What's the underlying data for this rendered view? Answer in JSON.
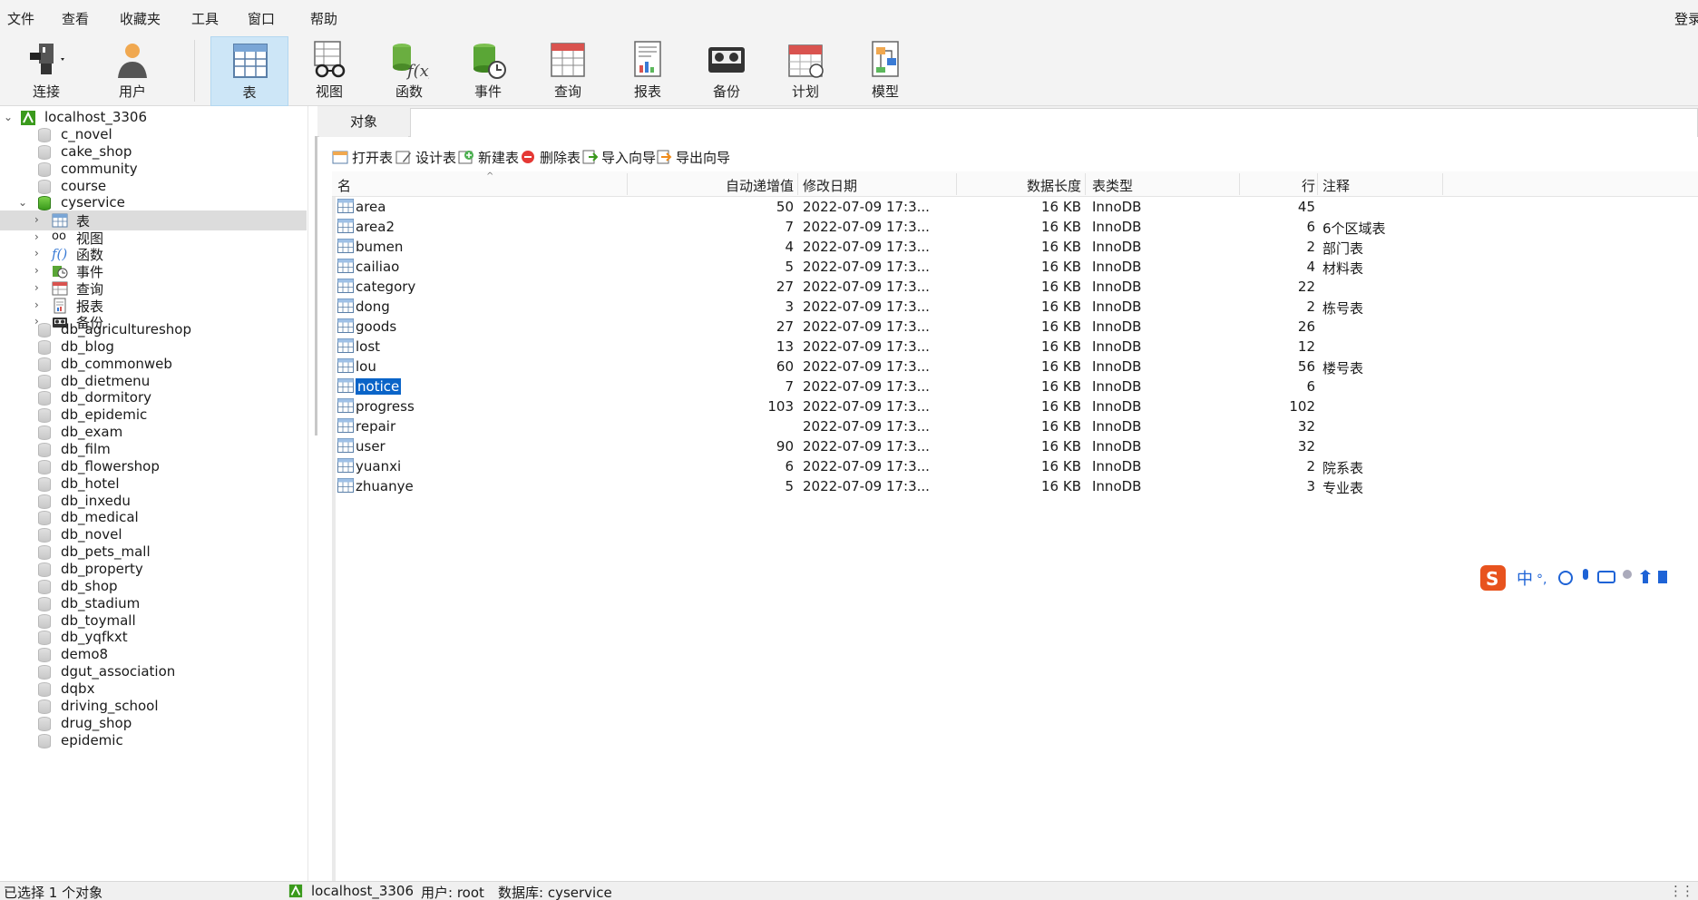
{
  "menu": {
    "items": [
      "文件",
      "查看",
      "收藏夹",
      "工具",
      "窗口",
      "帮助"
    ],
    "login": "登录"
  },
  "toolbar": {
    "buttons": [
      {
        "label": "连接",
        "icon": "connection-plug-icon"
      },
      {
        "label": "用户",
        "icon": "user-icon"
      },
      {
        "label": "表",
        "icon": "table-icon",
        "active": true
      },
      {
        "label": "视图",
        "icon": "view-glasses-icon"
      },
      {
        "label": "函数",
        "icon": "function-icon"
      },
      {
        "label": "事件",
        "icon": "event-clock-icon"
      },
      {
        "label": "查询",
        "icon": "query-icon"
      },
      {
        "label": "报表",
        "icon": "report-icon"
      },
      {
        "label": "备份",
        "icon": "backup-icon"
      },
      {
        "label": "计划",
        "icon": "schedule-calendar-icon"
      },
      {
        "label": "模型",
        "icon": "model-icon"
      }
    ]
  },
  "sidebar": {
    "connection": "localhost_3306",
    "databases_top": [
      "c_novel",
      "cake_shop",
      "community",
      "course"
    ],
    "open_db": "cyservice",
    "open_db_children": [
      {
        "label": "表",
        "icon": "table-icon",
        "selected": true
      },
      {
        "label": "视图",
        "icon": "view-glasses-icon"
      },
      {
        "label": "函数",
        "icon": "function-icon"
      },
      {
        "label": "事件",
        "icon": "event-clock-icon"
      },
      {
        "label": "查询",
        "icon": "query-icon"
      },
      {
        "label": "报表",
        "icon": "report-icon"
      },
      {
        "label": "备份",
        "icon": "backup-icon"
      }
    ],
    "databases_bottom": [
      "db_agricultureshop",
      "db_blog",
      "db_commonweb",
      "db_dietmenu",
      "db_dormitory",
      "db_epidemic",
      "db_exam",
      "db_film",
      "db_flowershop",
      "db_hotel",
      "db_inxedu",
      "db_medical",
      "db_novel",
      "db_pets_mall",
      "db_property",
      "db_shop",
      "db_stadium",
      "db_toymall",
      "db_yqfkxt",
      "demo8",
      "dgut_association",
      "dqbx",
      "driving_school",
      "drug_shop",
      "epidemic"
    ]
  },
  "tabs": {
    "objects": "对象"
  },
  "object_toolbar": [
    {
      "label": "打开表",
      "icon": "open-table-icon"
    },
    {
      "label": "设计表",
      "icon": "design-table-icon"
    },
    {
      "label": "新建表",
      "icon": "new-table-icon"
    },
    {
      "label": "删除表",
      "icon": "delete-table-icon"
    },
    {
      "label": "导入向导",
      "icon": "import-wizard-icon"
    },
    {
      "label": "导出向导",
      "icon": "export-wizard-icon"
    }
  ],
  "grid": {
    "columns": {
      "name": "名",
      "auto_inc": "自动递增值",
      "modified": "修改日期",
      "data_len": "数据长度",
      "engine": "表类型",
      "rows": "行",
      "comment": "注释"
    },
    "rows": [
      {
        "name": "area",
        "auto_inc": "50",
        "modified": "2022-07-09 17:3...",
        "data_len": "16 KB",
        "engine": "InnoDB",
        "rows": "45",
        "comment": ""
      },
      {
        "name": "area2",
        "auto_inc": "7",
        "modified": "2022-07-09 17:3...",
        "data_len": "16 KB",
        "engine": "InnoDB",
        "rows": "6",
        "comment": "6个区域表"
      },
      {
        "name": "bumen",
        "auto_inc": "4",
        "modified": "2022-07-09 17:3...",
        "data_len": "16 KB",
        "engine": "InnoDB",
        "rows": "2",
        "comment": "部门表"
      },
      {
        "name": "cailiao",
        "auto_inc": "5",
        "modified": "2022-07-09 17:3...",
        "data_len": "16 KB",
        "engine": "InnoDB",
        "rows": "4",
        "comment": "材料表"
      },
      {
        "name": "category",
        "auto_inc": "27",
        "modified": "2022-07-09 17:3...",
        "data_len": "16 KB",
        "engine": "InnoDB",
        "rows": "22",
        "comment": ""
      },
      {
        "name": "dong",
        "auto_inc": "3",
        "modified": "2022-07-09 17:3...",
        "data_len": "16 KB",
        "engine": "InnoDB",
        "rows": "2",
        "comment": "栋号表"
      },
      {
        "name": "goods",
        "auto_inc": "27",
        "modified": "2022-07-09 17:3...",
        "data_len": "16 KB",
        "engine": "InnoDB",
        "rows": "26",
        "comment": ""
      },
      {
        "name": "lost",
        "auto_inc": "13",
        "modified": "2022-07-09 17:3...",
        "data_len": "16 KB",
        "engine": "InnoDB",
        "rows": "12",
        "comment": ""
      },
      {
        "name": "lou",
        "auto_inc": "60",
        "modified": "2022-07-09 17:3...",
        "data_len": "16 KB",
        "engine": "InnoDB",
        "rows": "56",
        "comment": "楼号表"
      },
      {
        "name": "notice",
        "auto_inc": "7",
        "modified": "2022-07-09 17:3...",
        "data_len": "16 KB",
        "engine": "InnoDB",
        "rows": "6",
        "comment": "",
        "selected": true
      },
      {
        "name": "progress",
        "auto_inc": "103",
        "modified": "2022-07-09 17:3...",
        "data_len": "16 KB",
        "engine": "InnoDB",
        "rows": "102",
        "comment": ""
      },
      {
        "name": "repair",
        "auto_inc": "",
        "modified": "2022-07-09 17:3...",
        "data_len": "16 KB",
        "engine": "InnoDB",
        "rows": "32",
        "comment": ""
      },
      {
        "name": "user",
        "auto_inc": "90",
        "modified": "2022-07-09 17:3...",
        "data_len": "16 KB",
        "engine": "InnoDB",
        "rows": "32",
        "comment": ""
      },
      {
        "name": "yuanxi",
        "auto_inc": "6",
        "modified": "2022-07-09 17:3...",
        "data_len": "16 KB",
        "engine": "InnoDB",
        "rows": "2",
        "comment": "院系表"
      },
      {
        "name": "zhuanye",
        "auto_inc": "5",
        "modified": "2022-07-09 17:3...",
        "data_len": "16 KB",
        "engine": "InnoDB",
        "rows": "3",
        "comment": "专业表"
      }
    ]
  },
  "ime": {
    "mode": "中",
    "punct": "°,"
  },
  "status": {
    "selection": "已选择 1 个对象",
    "connection": "localhost_3306",
    "user": "用户: root",
    "database": "数据库: cyservice"
  },
  "colors": {
    "accent": "#0a64c8",
    "active_tool": "#cde6f7",
    "green_db": "#3a9a1c"
  }
}
